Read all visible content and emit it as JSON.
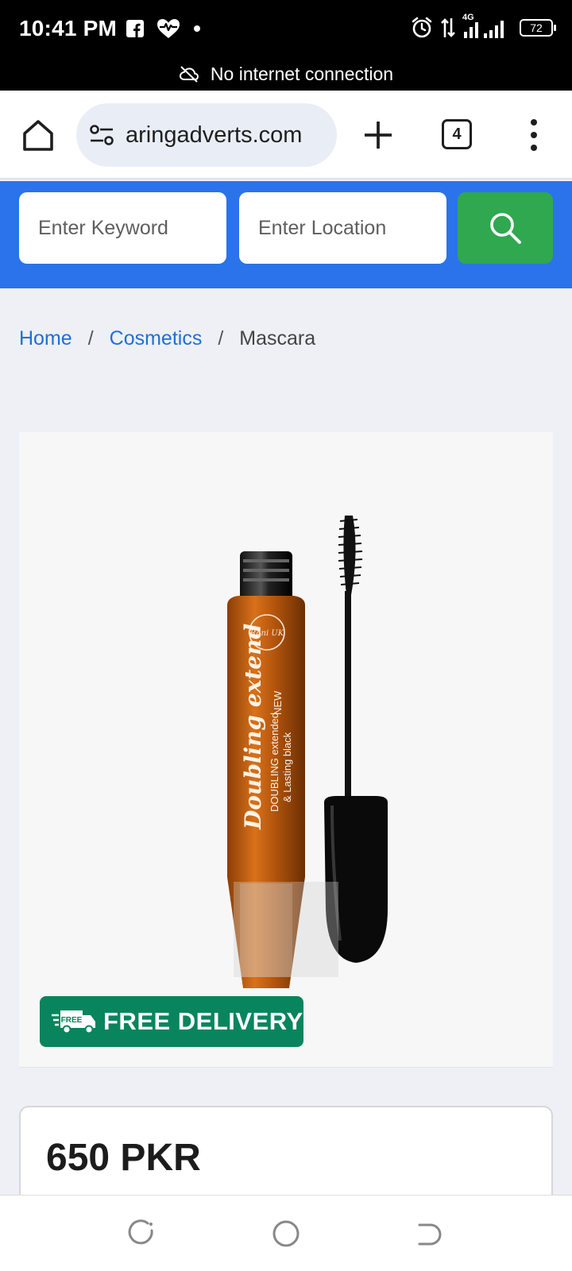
{
  "status_bar": {
    "time": "10:41 PM",
    "network": "4G",
    "battery": "72",
    "icons": [
      "facebook-icon",
      "heart-monitor-icon",
      "dot-icon",
      "alarm-icon",
      "data-arrows-icon",
      "signal-icon",
      "battery-icon"
    ]
  },
  "offline_banner": {
    "text": "No internet connection",
    "icon": "cloud-off-icon"
  },
  "browser": {
    "url": "aringadverts.com",
    "tab_count": "4",
    "icons": [
      "home-icon",
      "site-settings-icon",
      "plus-icon",
      "tabs-icon",
      "more-vert-icon"
    ]
  },
  "search": {
    "keyword_placeholder": "Enter Keyword",
    "location_placeholder": "Enter Location",
    "icon": "search-icon"
  },
  "breadcrumb": {
    "home": "Home",
    "category": "Cosmetics",
    "current": "Mascara",
    "separator": "/"
  },
  "product_image": {
    "badge_prefix": "FREE",
    "badge_text": "FREE DELIVERY",
    "brand": "Rani UK",
    "tube_title": "Doubling extend",
    "tube_line1": "DOUBLING extended",
    "tube_line2": "& Lasting black",
    "tube_new": "NEW"
  },
  "price": {
    "text": "650 PKR"
  },
  "colors": {
    "brand_blue": "#2a73eb",
    "search_green": "#2fa84f",
    "badge_green": "#08855c",
    "link_blue": "#1f6fd6"
  },
  "nav": {
    "icons": [
      "recents-icon",
      "home-circle-icon",
      "back-icon"
    ]
  }
}
